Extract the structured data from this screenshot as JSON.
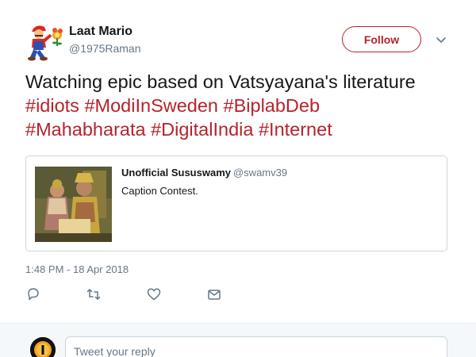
{
  "author": {
    "display_name": "Laat Mario",
    "handle": "@1975Raman"
  },
  "follow_label": "Follow",
  "tweet": {
    "text_plain": "Watching epic based on Vatsyayana's literature",
    "hashtags": [
      "#idiots",
      "#ModiInSweden",
      "#BiplabDeb",
      "#Mahabharata",
      "#DigitalIndia",
      "#Internet"
    ]
  },
  "quoted_tweet": {
    "display_name": "Unofficial Sususwamy",
    "handle": "@swamv39",
    "text": "Caption Contest."
  },
  "timestamp": "1:48 PM - 18 Apr 2018",
  "actions": {
    "icons": [
      "reply-icon",
      "retweet-icon",
      "like-icon",
      "message-icon"
    ]
  },
  "reply": {
    "placeholder": "Tweet your reply"
  },
  "colors": {
    "accent": "#b5232c",
    "secondary_text": "#657786",
    "border": "#ccd6dd"
  }
}
